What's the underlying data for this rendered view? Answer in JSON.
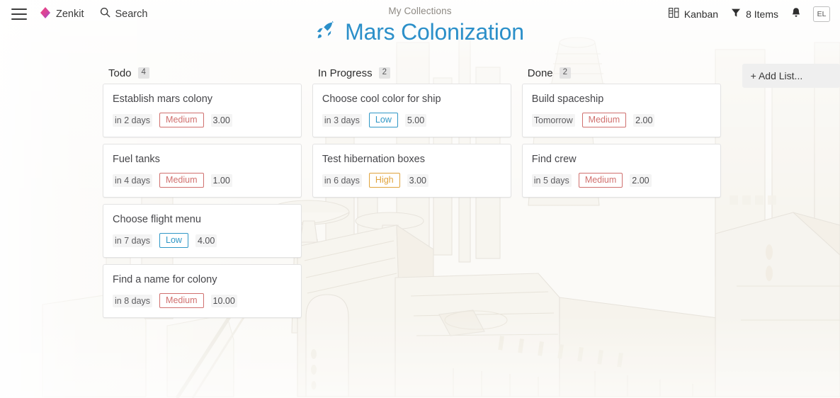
{
  "topbar": {
    "menu_icon": "hamburger-icon",
    "brand": {
      "label": "Zenkit",
      "logo_icon": "zenkit-diamond-logo"
    },
    "search": {
      "label": "Search",
      "icon": "search-icon"
    },
    "view": {
      "label": "Kanban",
      "icon": "kanban-grid-icon"
    },
    "filter": {
      "label": "8 Items",
      "icon": "filter-funnel-icon"
    },
    "notifications_icon": "bell-icon",
    "avatar": {
      "initials": "EL"
    }
  },
  "header": {
    "collections_label": "My Collections",
    "board_title": "Mars Colonization",
    "board_icon": "rocket-icon",
    "title_color": "#2b8fc9"
  },
  "board": {
    "add_list_label": "+ Add List...",
    "lists": [
      {
        "name": "Todo",
        "count": "4",
        "cards": [
          {
            "title": "Establish mars colony",
            "date": "in 2 days",
            "priority": "Medium",
            "priority_level": "medium",
            "value": "3.00"
          },
          {
            "title": "Fuel tanks",
            "date": "in 4 days",
            "priority": "Medium",
            "priority_level": "medium",
            "value": "1.00"
          },
          {
            "title": "Choose flight menu",
            "date": "in 7 days",
            "priority": "Low",
            "priority_level": "low",
            "value": "4.00"
          },
          {
            "title": "Find a name for colony",
            "date": "in 8 days",
            "priority": "Medium",
            "priority_level": "medium",
            "value": "10.00"
          }
        ]
      },
      {
        "name": "In Progress",
        "count": "2",
        "cards": [
          {
            "title": "Choose cool color for ship",
            "date": "in 3 days",
            "priority": "Low",
            "priority_level": "low",
            "value": "5.00"
          },
          {
            "title": "Test hibernation boxes",
            "date": "in 6 days",
            "priority": "High",
            "priority_level": "high",
            "value": "3.00"
          }
        ]
      },
      {
        "name": "Done",
        "count": "2",
        "cards": [
          {
            "title": "Build spaceship",
            "date": "Tomorrow",
            "priority": "Medium",
            "priority_level": "medium",
            "value": "2.00"
          },
          {
            "title": "Find crew",
            "date": "in 5 days",
            "priority": "Medium",
            "priority_level": "medium",
            "value": "2.00"
          }
        ]
      }
    ]
  },
  "colors": {
    "accent_blue": "#2b8fc9",
    "priority_medium": "#d0706e",
    "priority_low": "#2f97c6",
    "priority_high": "#e0a33c"
  }
}
